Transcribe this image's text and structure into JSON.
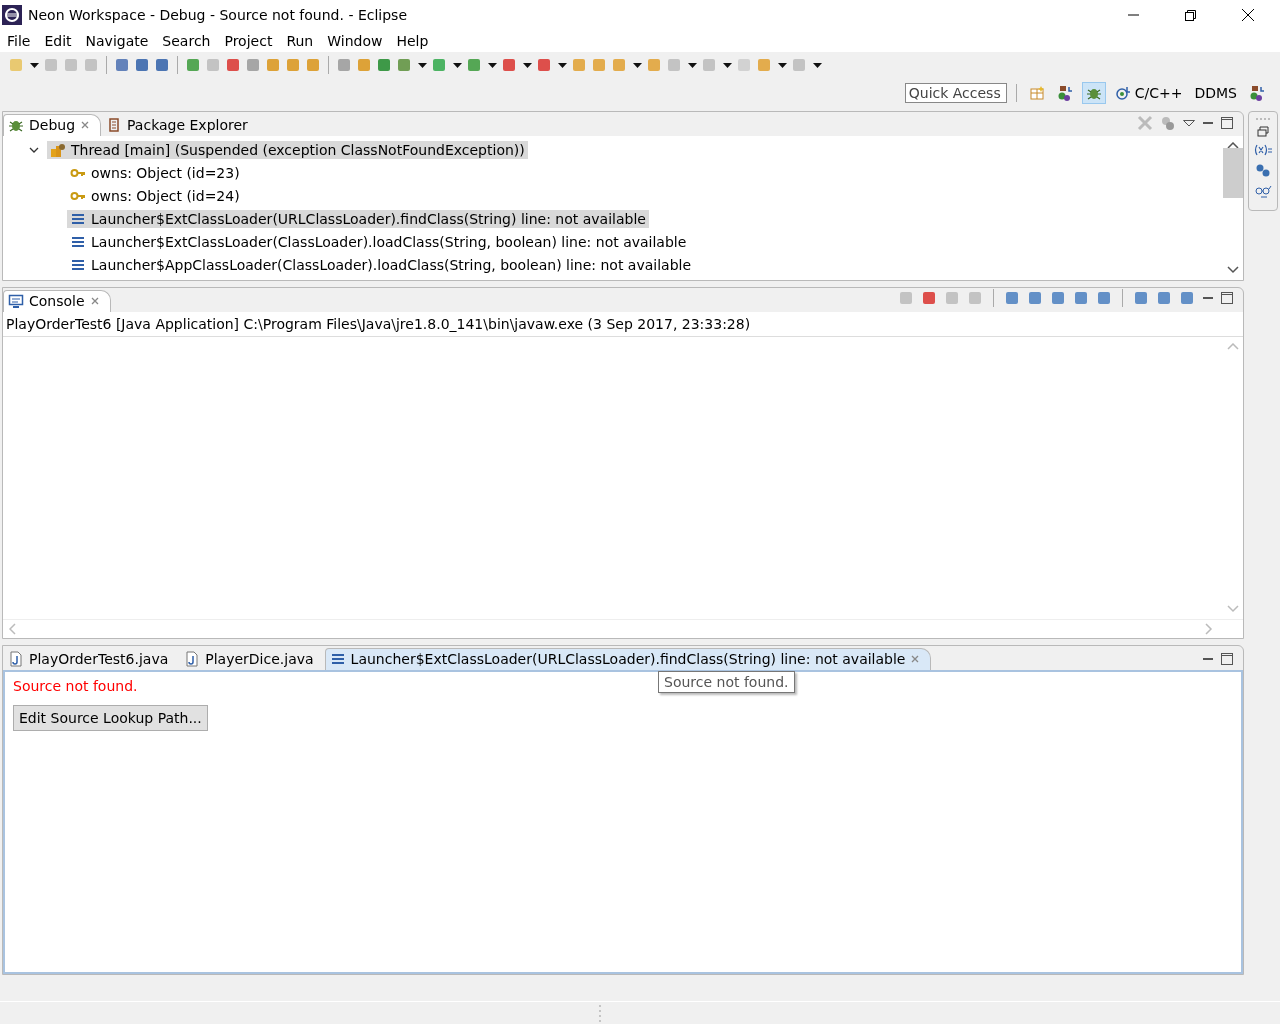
{
  "window": {
    "title": "Neon Workspace - Debug - Source not found. - Eclipse"
  },
  "menu": [
    "File",
    "Edit",
    "Navigate",
    "Search",
    "Project",
    "Run",
    "Window",
    "Help"
  ],
  "quick_access": {
    "placeholder": "Quick Access"
  },
  "perspectives": [
    {
      "kind": "open",
      "selected": false
    },
    {
      "kind": "java",
      "selected": false
    },
    {
      "kind": "debug",
      "selected": true
    },
    {
      "label": "C/C++",
      "kind": "cpp",
      "selected": false
    },
    {
      "label": "DDMS",
      "kind": "text",
      "selected": false
    },
    {
      "kind": "java",
      "selected": false
    }
  ],
  "debug_view": {
    "tabs": [
      {
        "label": "Debug",
        "kind": "debug",
        "selected": true,
        "closable": true
      },
      {
        "label": "Package Explorer",
        "kind": "package",
        "selected": false,
        "closable": false
      }
    ],
    "tree": [
      {
        "label": "Thread [main] (Suspended (exception ClassNotFoundException))",
        "kind": "thread",
        "expanded": true,
        "selected": true,
        "children": [
          {
            "label": "owns: Object  (id=23)",
            "kind": "lock",
            "selected": false
          },
          {
            "label": "owns: Object  (id=24)",
            "kind": "lock",
            "selected": false
          },
          {
            "label": "Launcher$ExtClassLoader(URLClassLoader).findClass(String) line: not available",
            "kind": "frame",
            "selected": true
          },
          {
            "label": "Launcher$ExtClassLoader(ClassLoader).loadClass(String, boolean) line: not available",
            "kind": "frame",
            "selected": false
          },
          {
            "label": "Launcher$AppClassLoader(ClassLoader).loadClass(String, boolean) line: not available",
            "kind": "frame",
            "selected": false
          }
        ]
      }
    ]
  },
  "console": {
    "tabs": [
      {
        "label": "Console",
        "kind": "console",
        "selected": true,
        "closable": true
      }
    ],
    "process": "PlayOrderTest6 [Java Application] C:\\Program Files\\Java\\jre1.8.0_141\\bin\\javaw.exe (3 Sep 2017, 23:33:28)"
  },
  "editor": {
    "tabs": [
      {
        "label": "PlayOrderTest6.java",
        "kind": "java",
        "selected": false,
        "closable": false
      },
      {
        "label": "PlayerDice.java",
        "kind": "java",
        "selected": false,
        "closable": false
      },
      {
        "label": "Launcher$ExtClassLoader(URLClassLoader).findClass(String) line: not available",
        "kind": "frame",
        "selected": true,
        "closable": true
      }
    ],
    "message": "Source not found.",
    "button": "Edit Source Lookup Path...",
    "tooltip": "Source not found."
  }
}
